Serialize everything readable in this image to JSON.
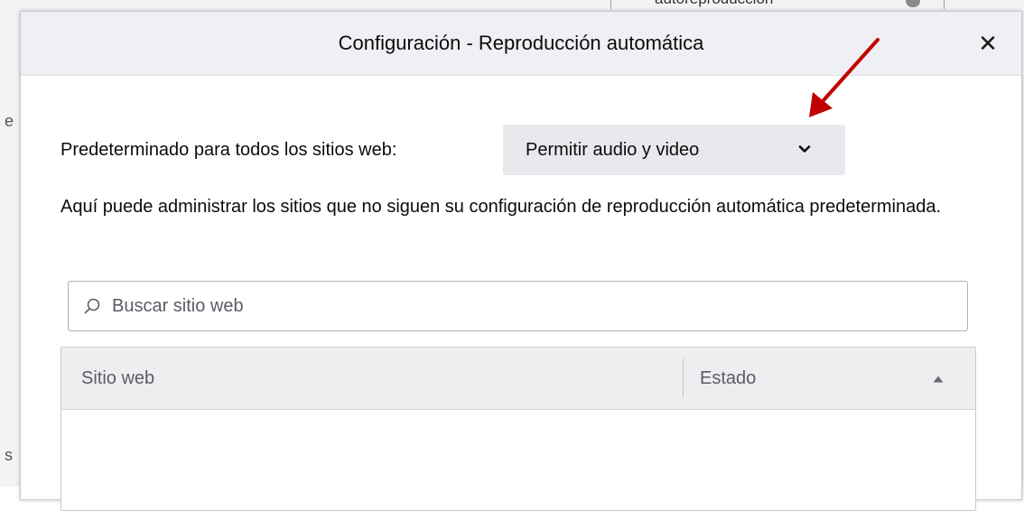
{
  "background": {
    "search_text": "autoreproducción",
    "edge_char_1": "e",
    "edge_char_2": "s"
  },
  "dialog": {
    "title": "Configuración - Reproducción automática",
    "close_glyph": "✕"
  },
  "default_setting": {
    "label": "Predeterminado para todos los sitios web:",
    "selected": "Permitir audio y video"
  },
  "description": "Aquí puede administrar los sitios que no siguen su configuración de reproducción automática predeterminada.",
  "search": {
    "placeholder": "Buscar sitio web",
    "value": ""
  },
  "table": {
    "columns": [
      "Sitio web",
      "Estado"
    ],
    "sort_column": "Estado",
    "sort_direction": "ascending",
    "rows": []
  },
  "icons": {
    "close": "close-icon",
    "chevron": "chevron-down-icon",
    "search": "search-icon",
    "sort": "sort-ascending-icon"
  },
  "colors": {
    "annotation_arrow": "#c00000",
    "select_bg": "#e9e9ed",
    "titlebar_bg": "#f0f0f4",
    "table_header_bg": "#eeeef0"
  }
}
